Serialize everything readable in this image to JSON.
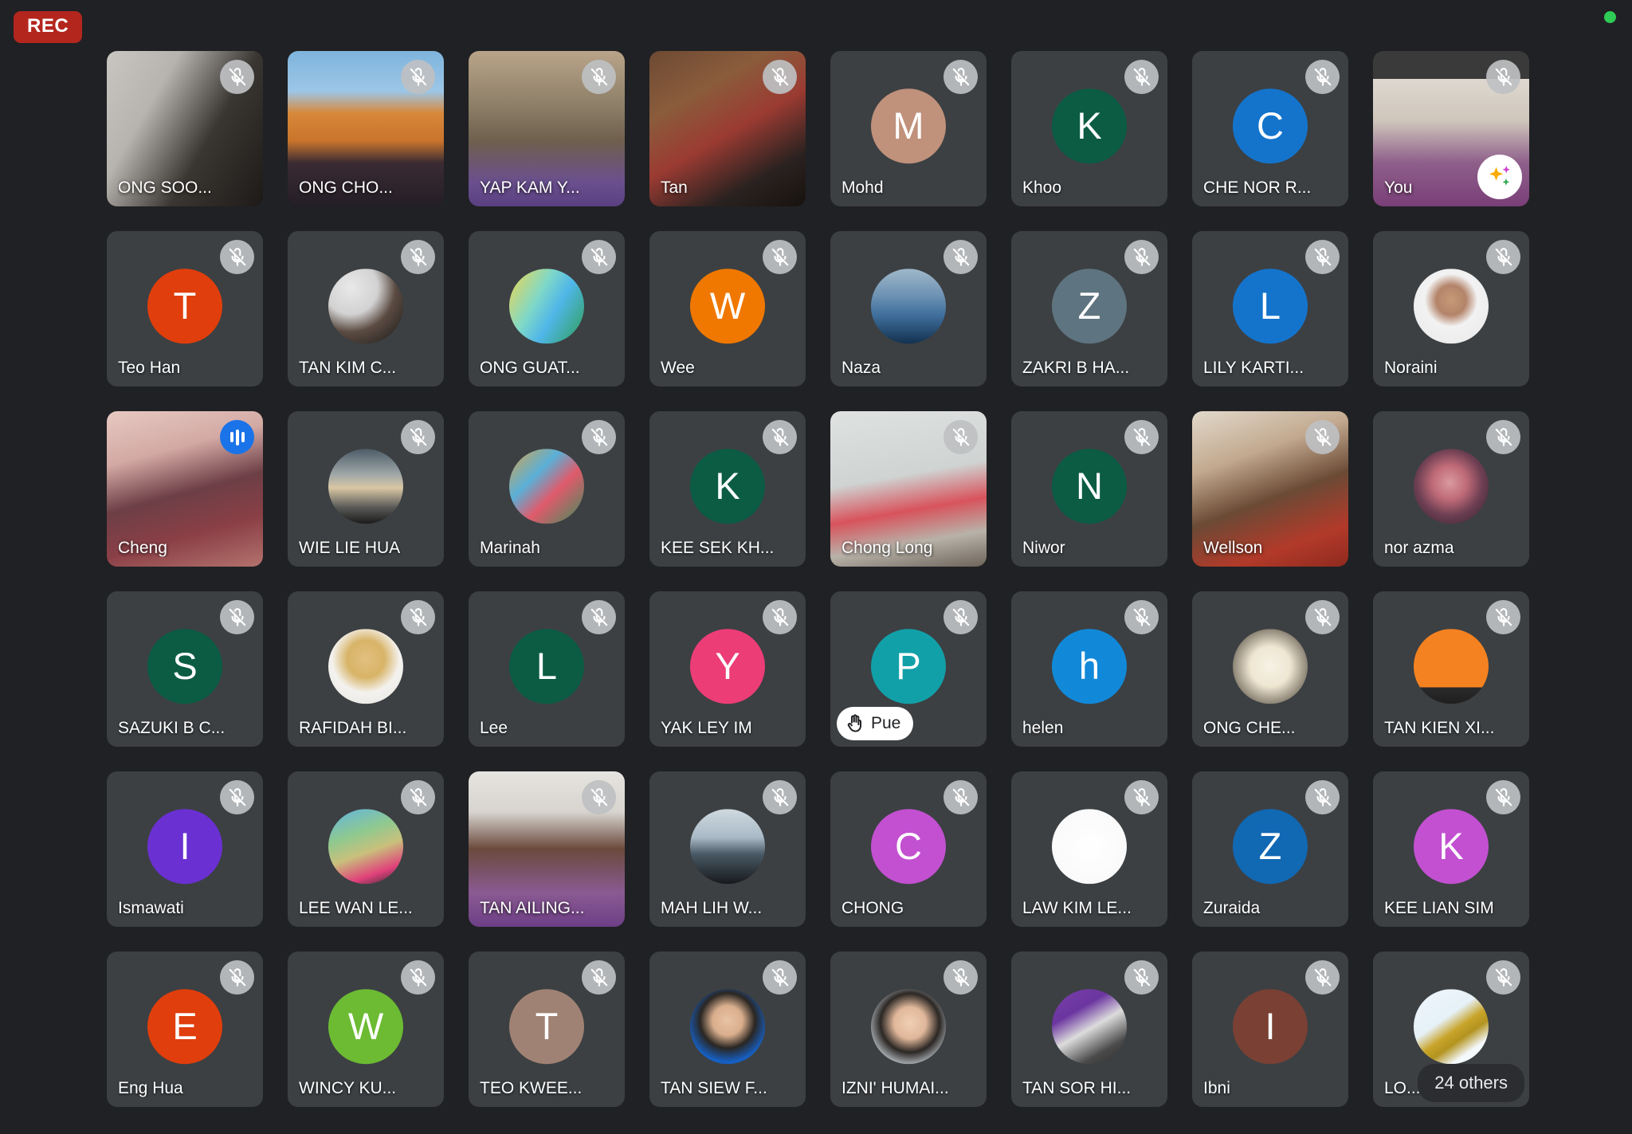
{
  "app": {
    "window_background": "#202124",
    "tile_background": "#3c4043"
  },
  "topbar": {
    "rec_label": "REC",
    "rec_color": "#b3261e",
    "status_dot_color": "#2ecc55",
    "status_dot_name": "recording-active-dot"
  },
  "overflow": {
    "label": "24 others"
  },
  "icons": {
    "mic_off": "mic-off-icon",
    "speaking": "speaking-indicator-icon",
    "raised_hand": "raised-hand-icon",
    "effects": "visual-effects-sparkle-icon"
  },
  "grid": {
    "columns": 8,
    "rows": 6,
    "participants": [
      {
        "name": "ONG SOO...",
        "kind": "video",
        "muted": true,
        "feed": "linear-gradient(120deg,#c9c6c2 0%,#b7b3ae 30%,#3a3632 62%,#1d1a18 100%)"
      },
      {
        "name": "ONG CHO...",
        "kind": "video",
        "muted": true,
        "feed": "linear-gradient(180deg,#7fb4dd 0%,#9cc6e6 26%,#d8883a 40%,#c9742c 58%,#3a2b33 72%,#241e26 100%)"
      },
      {
        "name": "YAP KAM Y...",
        "kind": "video",
        "muted": true,
        "feed": "linear-gradient(180deg,#b9a489 0%,#8d7f68 35%,#6f5f4e 58%,#6a4f8f 85%,#5a4080 100%)"
      },
      {
        "name": "Tan",
        "kind": "video",
        "muted": true,
        "feed": "linear-gradient(150deg,#6d4a33 0%,#8a5c3c 28%,#9b3b32 52%,#2a2220 78%,#17120f 100%)"
      },
      {
        "name": "Mohd",
        "kind": "avatar",
        "muted": true,
        "initial": "M",
        "color": "#c0917b"
      },
      {
        "name": "Khoo",
        "kind": "avatar",
        "muted": true,
        "initial": "K",
        "color": "#0b5c43"
      },
      {
        "name": "CHE NOR R...",
        "kind": "avatar",
        "muted": true,
        "initial": "C",
        "color": "#1474cc"
      },
      {
        "name": "You",
        "kind": "video",
        "muted": true,
        "self": true,
        "effects": true,
        "feed": "linear-gradient(180deg,#3a3a3a 0%,#3a3a3a 18%,#ded8d0 18%,#cfc6bb 45%,#8e5f8a 72%,#7a3f78 100%)"
      },
      {
        "name": "Teo Han",
        "kind": "avatar",
        "muted": true,
        "initial": "T",
        "color": "#e03e0c"
      },
      {
        "name": "TAN KIM C...",
        "kind": "photo",
        "muted": true,
        "photo": "radial-gradient(circle at 30% 25%,#e9e9e9 0%,#d2d2d2 35%,#5b4b42 58%,#171717 100%)"
      },
      {
        "name": "ONG GUAT...",
        "kind": "photo",
        "muted": true,
        "photo": "linear-gradient(120deg,#f2d64c 0%,#7fd8c8 38%,#4fb6e8 60%,#2f9e53 100%)"
      },
      {
        "name": "Wee",
        "kind": "avatar",
        "muted": true,
        "initial": "W",
        "color": "#f07800"
      },
      {
        "name": "Naza",
        "kind": "photo",
        "muted": true,
        "photo": "linear-gradient(180deg,#9fb8c9 0%,#6f93b4 35%,#3f6f9c 62%,#13314f 100%)"
      },
      {
        "name": "ZAKRI B HA...",
        "kind": "avatar",
        "muted": true,
        "initial": "Z",
        "color": "#5e7480"
      },
      {
        "name": "LILY KARTI...",
        "kind": "avatar",
        "muted": true,
        "initial": "L",
        "color": "#1474cc"
      },
      {
        "name": "Noraini",
        "kind": "photo",
        "muted": true,
        "photo": "radial-gradient(circle at 50% 42%,#c79a78 0%,#b4846a 26%,#f2f2f2 46%,#e8e8e8 100%)"
      },
      {
        "name": "Cheng",
        "kind": "video",
        "muted": false,
        "speaking": true,
        "feed": "linear-gradient(165deg,#e7c9c2 0%,#d3a9a4 28%,#6d3f46 52%,#8a3f46 74%,#b3726d 100%)"
      },
      {
        "name": "WIE LIE HUA",
        "kind": "photo",
        "muted": true,
        "photo": "linear-gradient(180deg,#4d5c68 0%,#9fa7a8 34%,#d9c7a4 52%,#5a5a58 78%,#1b1b1b 100%)"
      },
      {
        "name": "Marinah",
        "kind": "photo",
        "muted": true,
        "photo": "linear-gradient(135deg,#d7a24a 0%,#5ab0d8 35%,#e05a6b 60%,#3a8f5c 100%)"
      },
      {
        "name": "KEE SEK KH...",
        "kind": "avatar",
        "muted": true,
        "initial": "K",
        "color": "#0b5c43"
      },
      {
        "name": "Chong Long",
        "kind": "video",
        "muted": true,
        "feed": "linear-gradient(170deg,#dfe2e1 0%,#cfd3d2 42%,#d8535c 62%,#b8b2a8 80%,#6d645a 100%)"
      },
      {
        "name": "Niwor",
        "kind": "avatar",
        "muted": true,
        "initial": "N",
        "color": "#0b5c43"
      },
      {
        "name": "Wellson",
        "kind": "video",
        "muted": true,
        "feed": "linear-gradient(160deg,#e2d9cb 0%,#c2a98f 30%,#6b4a35 55%,#b23a2a 80%,#8f2a1e 100%)"
      },
      {
        "name": "nor azma",
        "kind": "photo",
        "muted": true,
        "photo": "radial-gradient(circle at 48% 45%,#d99aa0 0%,#c06b78 30%,#6d3f52 58%,#2c2028 100%)"
      },
      {
        "name": "SAZUKI B C...",
        "kind": "avatar",
        "muted": true,
        "initial": "S",
        "color": "#0b5c43"
      },
      {
        "name": "RAFIDAH BI...",
        "kind": "photo",
        "muted": true,
        "photo": "radial-gradient(circle at 50% 40%,#e2c07f 0%,#d8b468 32%,#f4f2ef 58%,#e6e4e0 100%)"
      },
      {
        "name": "Lee",
        "kind": "avatar",
        "muted": true,
        "initial": "L",
        "color": "#0b5c43"
      },
      {
        "name": "YAK LEY IM",
        "kind": "avatar",
        "muted": true,
        "initial": "Y",
        "color": "#ec3d77"
      },
      {
        "name": "Pue",
        "kind": "avatar",
        "muted": true,
        "initial": "P",
        "color": "#12a0a8",
        "hand_raised": true
      },
      {
        "name": "helen",
        "kind": "avatar",
        "muted": true,
        "initial": "h",
        "color": "#1289d8"
      },
      {
        "name": "ONG CHE...",
        "kind": "photo",
        "muted": true,
        "photo": "radial-gradient(circle at 50% 50%,#f6f2e6 0%,#efe6d2 38%,#8d8576 70%,#4a463f 100%)"
      },
      {
        "name": "TAN KIEN XI...",
        "kind": "photo",
        "muted": true,
        "photo": "linear-gradient(180deg,#f58220 0%,#f58220 78%,#2a2a2a 78%,#1f1f1f 100%)"
      },
      {
        "name": "Ismawati",
        "kind": "avatar",
        "muted": true,
        "initial": "I",
        "color": "#6a30d1"
      },
      {
        "name": "LEE WAN LE...",
        "kind": "photo",
        "muted": true,
        "photo": "linear-gradient(160deg,#5fb4e4 0%,#8fc98f 34%,#c9c07c 56%,#e0417a 80%,#2a2a33 100%)"
      },
      {
        "name": "TAN AILING...",
        "kind": "video",
        "muted": true,
        "feed": "linear-gradient(180deg,#e6e4e0 0%,#d8d4cf 26%,#6a4a3c 50%,#8a5a92 78%,#6d3f86 100%)"
      },
      {
        "name": "MAH LIH W...",
        "kind": "photo",
        "muted": true,
        "photo": "linear-gradient(180deg,#cfd9df 0%,#a9bac6 38%,#4a5a66 60%,#17191c 100%)"
      },
      {
        "name": "CHONG",
        "kind": "avatar",
        "muted": true,
        "initial": "C",
        "color": "#c250d0"
      },
      {
        "name": "LAW KIM LE...",
        "kind": "photo",
        "muted": true,
        "photo": "radial-gradient(circle at 50% 50%,#ffffff 0%,#fafafa 70%,#e3e3e3 100%)"
      },
      {
        "name": "Zuraida",
        "kind": "avatar",
        "muted": true,
        "initial": "Z",
        "color": "#1168b3"
      },
      {
        "name": "KEE LIAN SIM",
        "kind": "avatar",
        "muted": true,
        "initial": "K",
        "color": "#c250d0"
      },
      {
        "name": "Eng Hua",
        "kind": "avatar",
        "muted": true,
        "initial": "E",
        "color": "#e03e0c"
      },
      {
        "name": "WINCY KU...",
        "kind": "avatar",
        "muted": true,
        "initial": "W",
        "color": "#6cbb33"
      },
      {
        "name": "TEO KWEE...",
        "kind": "avatar",
        "muted": true,
        "initial": "T",
        "color": "#a08274"
      },
      {
        "name": "TAN SIEW F...",
        "kind": "photo",
        "muted": true,
        "photo": "radial-gradient(circle at 50% 42%,#e8c3a5 0%,#d9ae8d 26%,#2a2622 48%,#1660c4 72%,#1257b3 100%)"
      },
      {
        "name": "IZNI' HUMAI...",
        "kind": "photo",
        "muted": true,
        "photo": "radial-gradient(circle at 52% 45%,#f0cfb4 0%,#e0b79a 28%,#2b2724 52%,#cfd6dd 80%,#e8eef3 100%)"
      },
      {
        "name": "TAN SOR HI...",
        "kind": "photo",
        "muted": true,
        "photo": "linear-gradient(150deg,#7a3fa8 0%,#6b35a0 30%,#dcdcdc 52%,#4a4a4a 78%,#2b2b2b 100%)"
      },
      {
        "name": "Ibni",
        "kind": "avatar",
        "muted": true,
        "initial": "I",
        "color": "#7a4034"
      },
      {
        "name": "LO...",
        "kind": "photo",
        "muted": true,
        "overflow": true,
        "photo": "linear-gradient(145deg,#eef6fb 0%,#e6f1f8 40%,#c8a42a 55%,#b3931f 65%,#f4f9fc 80%)"
      }
    ]
  }
}
